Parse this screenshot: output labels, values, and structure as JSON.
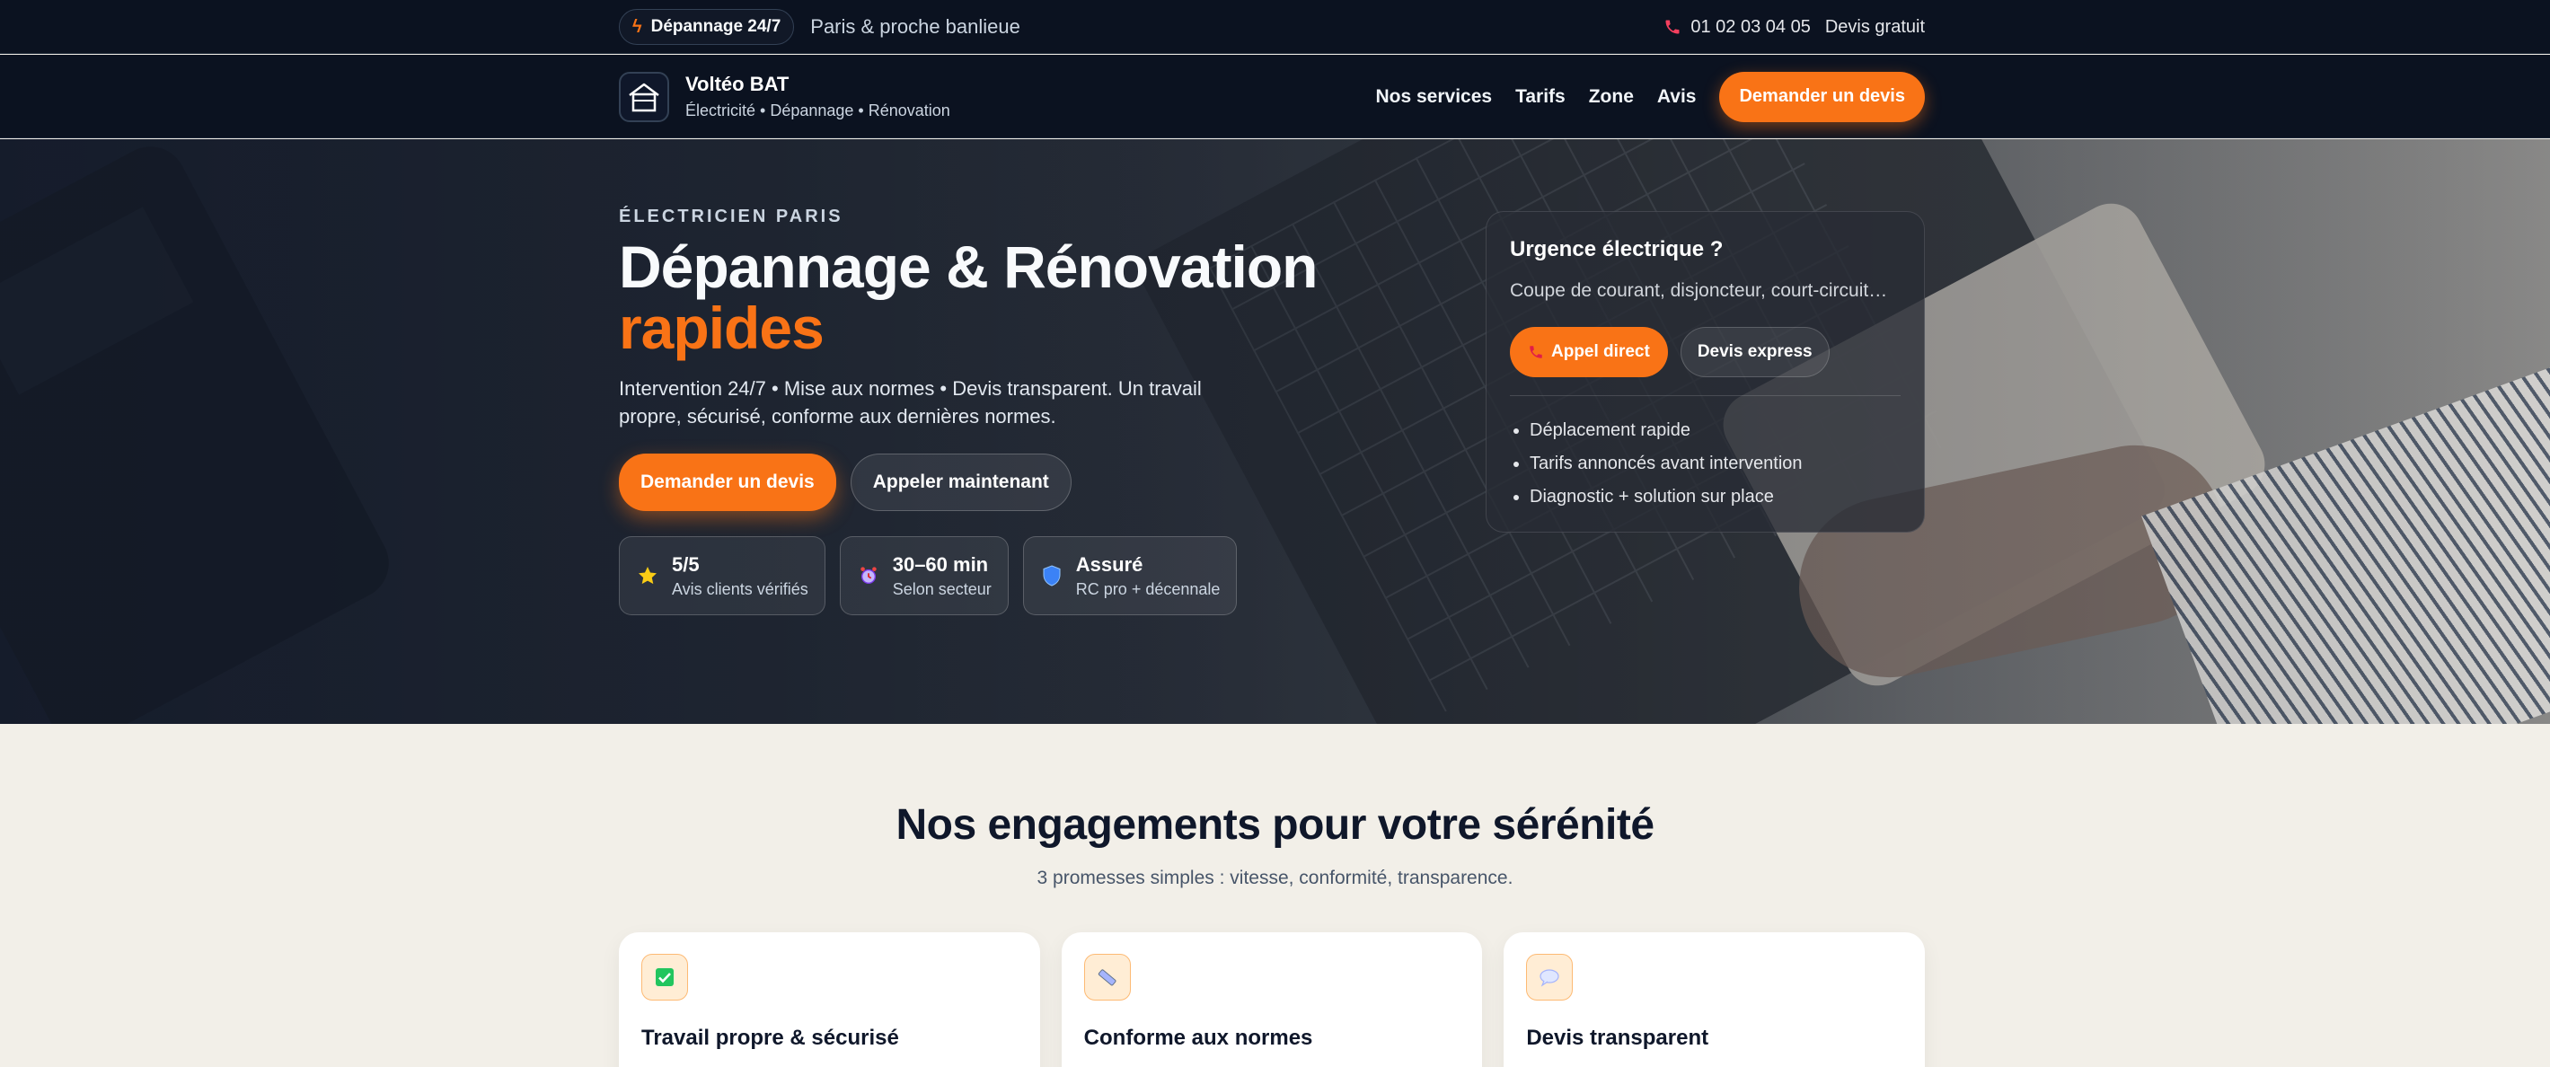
{
  "topbar": {
    "badge": "Dépannage 24/7",
    "area": "Paris & proche banlieue",
    "phone": "01 02 03 04 05",
    "quote_link": "Devis gratuit"
  },
  "nav": {
    "brand_name": "Voltéo BAT",
    "brand_tagline": "Électricité • Dépannage • Rénovation",
    "links": [
      "Nos services",
      "Tarifs",
      "Zone",
      "Avis"
    ],
    "cta": "Demander un devis"
  },
  "hero": {
    "eyebrow": "ÉLECTRICIEN PARIS",
    "title": "Dépannage & Rénovation",
    "title_accent": "rapides",
    "subtitle": "Intervention 24/7 • Mise aux normes • Devis transparent. Un travail propre, sécurisé, conforme aux dernières normes.",
    "primary_cta": "Demander un devis",
    "secondary_cta": "Appeler maintenant",
    "stats": [
      {
        "value": "5/5",
        "label": "Avis clients vérifiés",
        "icon": "star-icon"
      },
      {
        "value": "30–60 min",
        "label": "Selon secteur",
        "icon": "alarm-clock-icon"
      },
      {
        "value": "Assuré",
        "label": "RC pro + décennale",
        "icon": "shield-icon"
      }
    ]
  },
  "urgency": {
    "title": "Urgence électrique ?",
    "text": "Coupe de courant, disjoncteur, court-circuit…",
    "call_button": "Appel direct",
    "express_button": "Devis express",
    "items": [
      "Déplacement rapide",
      "Tarifs annoncés avant intervention",
      "Diagnostic + solution sur place"
    ]
  },
  "engagements": {
    "title": "Nos engagements pour votre sérénité",
    "subtitle": "3 promesses simples : vitesse, conformité, transparence.",
    "cards": [
      {
        "title": "Travail propre & sécurisé",
        "icon": "check-box-icon"
      },
      {
        "title": "Conforme aux normes",
        "icon": "ruler-icon"
      },
      {
        "title": "Devis transparent",
        "icon": "speech-bubble-icon"
      }
    ]
  },
  "colors": {
    "accent": "#f97316",
    "dark": "#0b1220",
    "section_bg": "#f2efe8"
  }
}
